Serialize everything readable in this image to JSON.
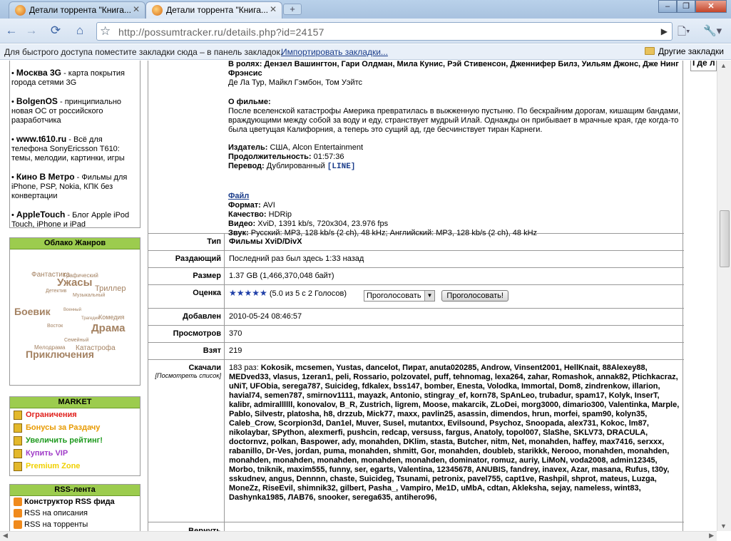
{
  "browser": {
    "tabs": [
      {
        "title": "Детали торрента \"Книга...",
        "active": false
      },
      {
        "title": "Детали торрента \"Книга...",
        "active": true
      }
    ],
    "new_tab_label": "+",
    "url_host": "http://possumtracker.ru",
    "url_path": "/details.php?id=24157",
    "bookmarks_hint": "Для быстрого доступа поместите закладки сюда – в панель закладок.",
    "import_link": "Импортировать закладки...",
    "other_bookmarks": "Другие закладки"
  },
  "sidebar": {
    "news": [
      {
        "title": "Москва 3G",
        "text": " - карта покрытия города сетями 3G"
      },
      {
        "title": "BolgenOS",
        "text": " - принципиально новая ОС от российского разработчика"
      },
      {
        "title": "www.t610.ru",
        "text": " - Всё для телефона SonyEricsson T610: темы, мелодии, картинки, игры"
      },
      {
        "title": "Кино В Метро",
        "text": " - Фильмы для iPhone, PSP, Nokia, КПК без конвертации"
      },
      {
        "title": "AppleTouch",
        "text": " - Блог Apple iPod Touch, iPhone и iPad"
      }
    ],
    "cloud_title": "Облако Жанров",
    "cloud": [
      "Фантастика",
      "Графический",
      "Ужасы",
      "Триллер",
      "Детектив",
      "Музыкальный",
      "Боевик",
      "Военный",
      "Комедия",
      "Трагедия",
      "Восток",
      "Драма",
      "Семейный",
      "Мелодрама",
      "Катастрофа",
      "Приключения"
    ],
    "market_title": "MARKET",
    "market": [
      {
        "label": "Ограничения",
        "color": "#e0201c"
      },
      {
        "label": "Бонусы за Раздачу",
        "color": "#e89a00"
      },
      {
        "label": "Увеличить рейтинг!",
        "color": "#1f9a1f"
      },
      {
        "label": "Купить VIP",
        "color": "#a03cc8"
      },
      {
        "label": "Premium Zone",
        "color": "#f0d000"
      }
    ],
    "rss_title": "RSS-лента",
    "rss": [
      {
        "label": "Конструктор RSS фида",
        "bold": true
      },
      {
        "label": "RSS на описания",
        "bold": false
      },
      {
        "label": "RSS на торренты",
        "bold": false
      }
    ]
  },
  "details": {
    "cast_line1": "В ролях: Дензел Вашингтон, Гари Олдман, Мила Кунис, Рэй Стивенсон, Дженнифер Билз, Уильям Джонс, Дже Нинг Фрэнсис",
    "cast_line2": "Де Ла Тур, Майкл Гэмбон, Том Уэйтс",
    "about_label": "О фильме:",
    "about_text": "После вселенской катастрофы Америка превратилась в выжженную пустыню. По бескрайним дорогам, кишащим бандами, враждующими между собой за воду и еду, странствует мудрый Илай. Однажды он прибывает в мрачные края, где когда-то была цветущая Калифорния, а теперь это сущий ад, где бесчинствует тиран Карнеги.",
    "publisher_label": "Издатель:",
    "publisher": "США, Alcon Entertainment",
    "duration_label": "Продолжительность:",
    "duration": "01:57:36",
    "translation_label": "Перевод:",
    "translation": "Дублированный",
    "translation_tag": "[LINE]",
    "file_label": "Файл",
    "format_label": "Формат:",
    "format": "AVI",
    "quality_label": "Качество:",
    "quality": "HDRip",
    "video_label": "Видео:",
    "video": "XviD, 1391 kb/s, 720x304, 23.976 fps",
    "audio_label": "Звук:",
    "audio": "Русский: MP3, 128 kb/s (2 ch), 48 kHz; Английский: MP3, 128 kb/s (2 ch), 48 kHz"
  },
  "info": {
    "type_label": "Тип",
    "type_value": "Фильмы XviD/DivX",
    "seeder_label": "Раздающий",
    "seeder_value": "Последний раз был здесь 1:33 назад",
    "size_label": "Размер",
    "size_value": "1.37 GB (1,466,370,048 байт)",
    "rating_label": "Оценка",
    "rating_stars": "★★★★★",
    "rating_text": "(5.0 из 5 с 2 Голосов)",
    "vote_select": "Проголосовать",
    "vote_button": "Проголосовать!",
    "added_label": "Добавлен",
    "added_value": "2010-05-24 08:46:57",
    "views_label": "Просмотров",
    "views_value": "370",
    "taken_label": "Взят",
    "taken_value": "219",
    "leechers_label": "Скачали",
    "leechers_sub": "[Посмотреть список]",
    "leechers_count": "183 раз:",
    "leechers_list": "Kokosik, mcsemen, Yustas, dancelot, Пират, anuta020285, Androw, Vinsent2001, HellKnait, 88Alexey88, MEDved33, vlasus, 1zeran1, peli, Rossario, polzovatel, puff, tehnomag, lexa264, zahar, Romashok, annak82, Ptichkacraz, uNiT, UFObia, serega787, Suicideg, fdkalex, bss147, bomber, Enesta, Volodka, Immortal, Dom8, zindrenkow, illarion, havial74, semen787, smirnov1111, mayazk, Antonio, stingray_ef, korn78, SpAnLeo, trubadur, spam17, Kolyk, InserT, kalibr, admirallllll, konovalov, B_R, Zustrich, ligrem, Moose, makarcik, ZLoDei, morg3000, dimario300, Valentinka, Marple, Pablo, Silvestr, platosha, h8, drzzub, Mick77, maxx, pavlin25, asassin, dimendos, hrun, morfei, spam90, kolyn35, Caleb_Crow, Scorpion3d, Dan1el, Muver, Susel, mutantxx, Evilsound, Psychoz, Snoopada, alex731, Kokoc, lm87, nikolaybar, SPython, alexmerfi, pushcin, redcap, versuss, fargus, Anatoly, topol007, SlaShe, SKLV73, DRACULA, doctornvz, polkan, Baspower, ady, monahden, DKlim, stasta, Butcher, nitm, Net, monahden, haffey, max7416, serxxx, rabanillo, Dr-Ves, jordan, puma, monahden, shmitt, Gor, monahden, doubleb, starikkk, Nerooo, monahden, monahden, monahden, monahden, monahden, monahden, monahden, dominator, romuz, auriy, LiMoN, voda2008, admin12345, Morbo, tniknik, maxim555, funny, ser, egarts, Valentina, 12345678, ANUBIS, fandrey, inavex, Azar, masana, Rufus, t30y, sskudnev, angus, Dennnn, chaste, Suicideg, Tsunami, petronix, pavel755, capt1ve, Rashpil, shprot, mateus, Luzga, MonеZz, RiseEvil, shimnik32, gilbert, Pasha_, Vampiro, Me1D, uMbA, cdtan, Akleksha, sejay, nameless, wint83, Dashynka1985, ЛАВ76, snooker, serega635, antihero96,",
    "bottom_label": "Вернуть"
  },
  "right_sidebar": {
    "label": "Где л"
  }
}
